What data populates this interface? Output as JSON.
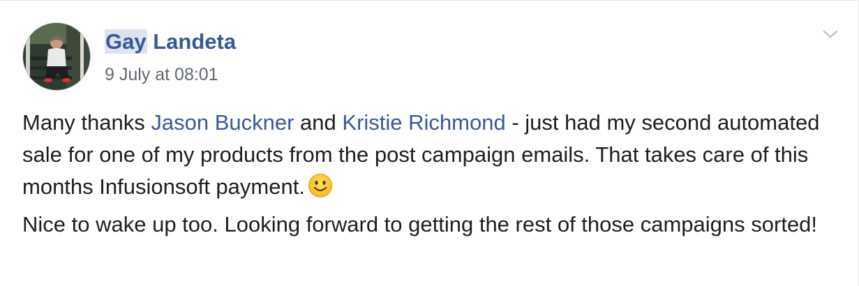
{
  "post": {
    "author_first": "Gay",
    "author_last": " Landeta",
    "timestamp": "9 July at 08:01",
    "menu_icon": "chevron-down-icon",
    "paragraph1": {
      "text_before": "Many thanks ",
      "mention1": "Jason Buckner",
      "text_middle": " and ",
      "mention2": "Kristie Richmond",
      "text_after": " - just had my second automated sale for one of my products from the post campaign emails. That takes care of this months Infusionsoft payment.",
      "emoji": "slightly-smiling-face-icon"
    },
    "paragraph2": "Nice to wake up too. Looking forward to getting the rest of those campaigns sorted!"
  },
  "colors": {
    "link": "#385898",
    "text": "#1c1e21",
    "muted": "#606770",
    "highlight": "#dde3ee"
  }
}
